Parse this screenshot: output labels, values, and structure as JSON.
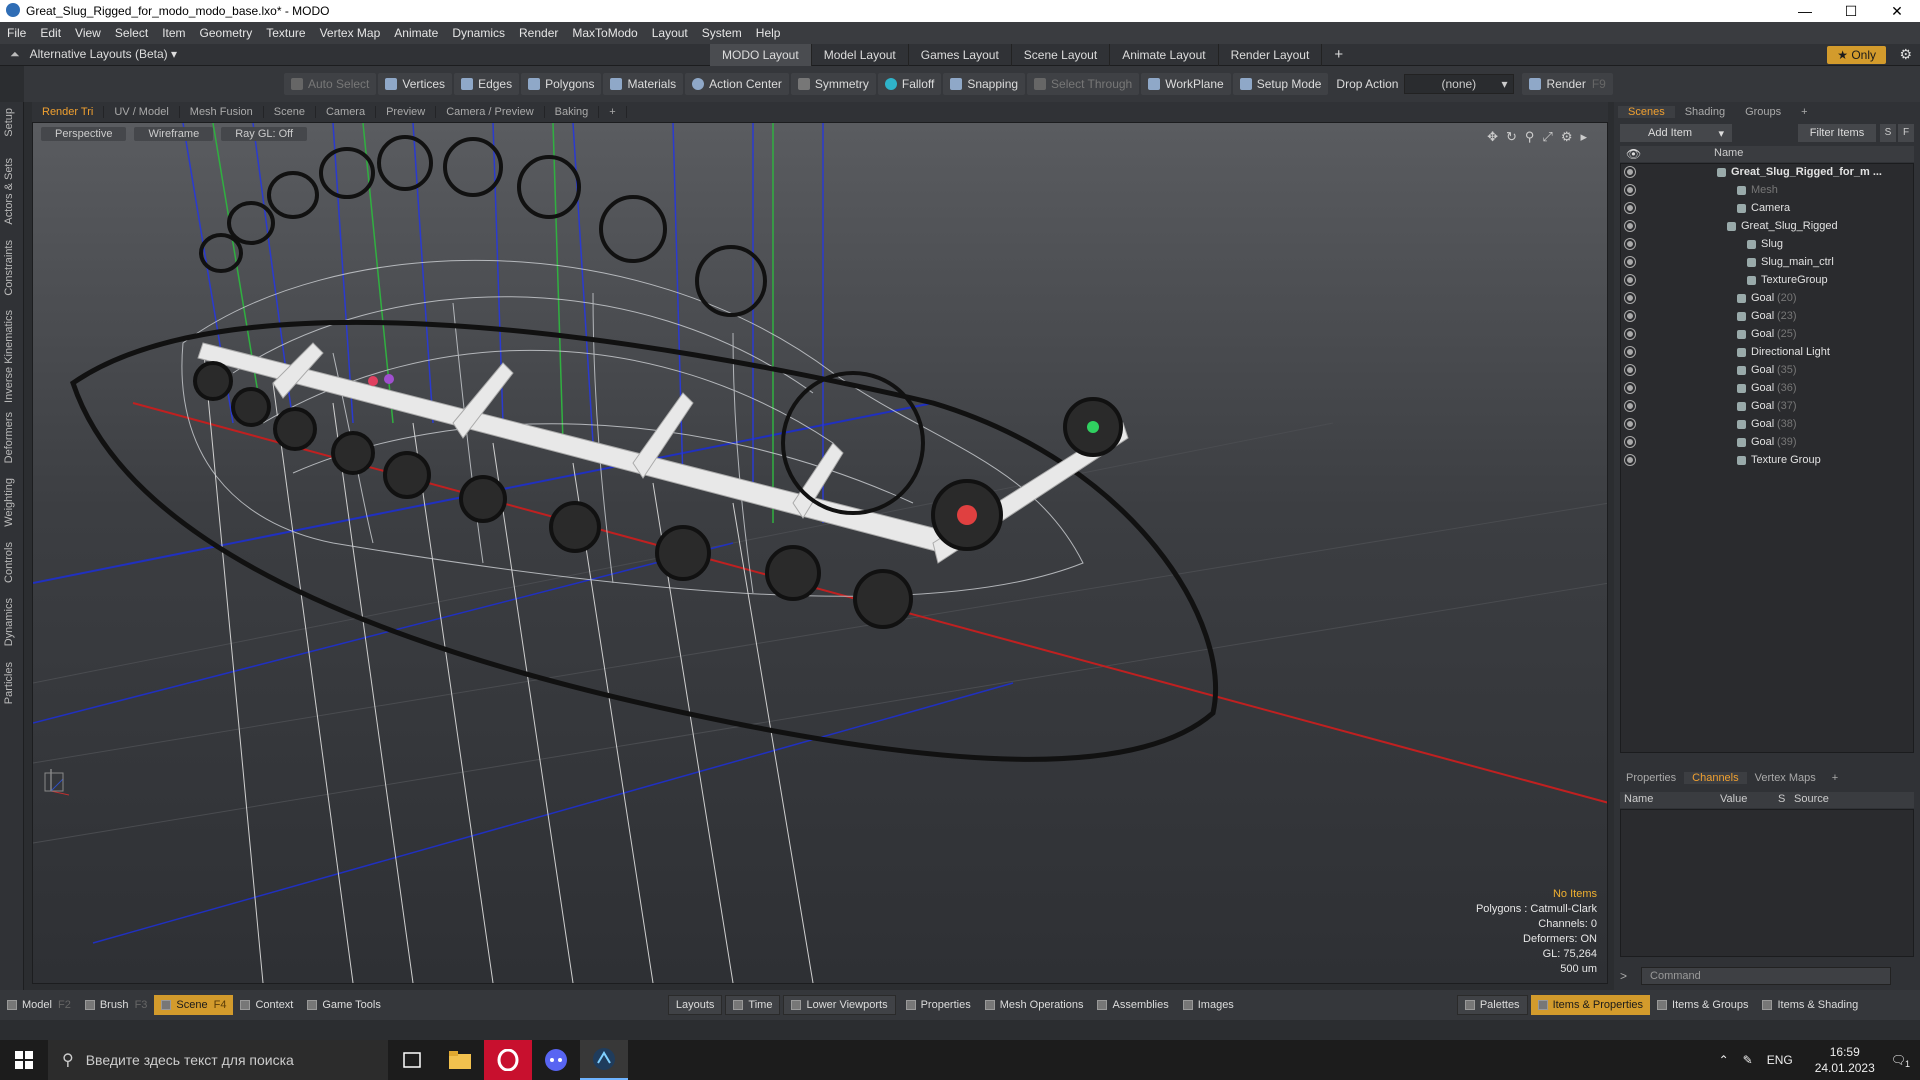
{
  "window": {
    "title": "Great_Slug_Rigged_for_modo_modo_base.lxo* - MODO",
    "controls": [
      "—",
      "☐",
      "✕"
    ]
  },
  "menu": [
    "File",
    "Edit",
    "View",
    "Select",
    "Item",
    "Geometry",
    "Texture",
    "Vertex Map",
    "Animate",
    "Dynamics",
    "Render",
    "MaxToModo",
    "Layout",
    "System",
    "Help"
  ],
  "layoutbar": {
    "alt_layouts": "Alternative Layouts (Beta) ▾",
    "tabs": [
      "MODO Layout",
      "Model Layout",
      "Games Layout",
      "Scene Layout",
      "Animate Layout",
      "Render Layout"
    ],
    "add": "+",
    "only": "★  Only"
  },
  "toolbar": {
    "auto_select": "Auto Select",
    "vertices": "Vertices",
    "edges": "Edges",
    "polygons": "Polygons",
    "materials": "Materials",
    "action_center": "Action Center",
    "symmetry": "Symmetry",
    "falloff": "Falloff",
    "snapping": "Snapping",
    "select_through": "Select Through",
    "workplane": "WorkPlane",
    "setup_mode": "Setup Mode",
    "drop_action": "Drop Action",
    "drop_value": "(none)",
    "render": "Render",
    "render_key": "F9"
  },
  "left_tabs": [
    "Setup",
    "Actors & Sets",
    "Constraints",
    "Inverse Kinematics",
    "Deformers",
    "Weighting",
    "Controls",
    "Dynamics",
    "Particles"
  ],
  "viewport_tabs": [
    "Render Tri",
    "UV / Model",
    "Mesh Fusion",
    "Scene",
    "Camera",
    "Preview",
    "Camera / Preview",
    "Baking",
    "+"
  ],
  "viewport": {
    "view": "Perspective",
    "shading": "Wireframe",
    "raygl": "Ray GL: Off",
    "info": {
      "no_items": "No Items",
      "polygons": "Polygons : Catmull-Clark",
      "channels": "Channels: 0",
      "deformers": "Deformers: ON",
      "gl": "GL: 75,264",
      "scale": "500 um"
    }
  },
  "scene_panel": {
    "tabs": [
      "Scenes",
      "Shading",
      "Groups",
      "+"
    ],
    "add_item": "Add Item",
    "filter_items": "Filter Items",
    "s_btn": "S",
    "f_btn": "F",
    "col_name": "Name",
    "items": [
      {
        "label": "Great_Slug_Rigged_for_m ...",
        "num": "",
        "indent": 0
      },
      {
        "label": "Mesh",
        "num": "",
        "indent": 2
      },
      {
        "label": "Camera",
        "num": "",
        "indent": 2
      },
      {
        "label": "Great_Slug_Rigged",
        "num": "",
        "indent": 1
      },
      {
        "label": "Slug",
        "num": "",
        "indent": 3
      },
      {
        "label": "Slug_main_ctrl",
        "num": "",
        "indent": 3
      },
      {
        "label": "TextureGroup",
        "num": "",
        "indent": 3
      },
      {
        "label": "Goal",
        "num": "(20)",
        "indent": 2
      },
      {
        "label": "Goal",
        "num": "(23)",
        "indent": 2
      },
      {
        "label": "Goal",
        "num": "(25)",
        "indent": 2
      },
      {
        "label": "Directional Light",
        "num": "",
        "indent": 2
      },
      {
        "label": "Goal",
        "num": "(35)",
        "indent": 2
      },
      {
        "label": "Goal",
        "num": "(36)",
        "indent": 2
      },
      {
        "label": "Goal",
        "num": "(37)",
        "indent": 2
      },
      {
        "label": "Goal",
        "num": "(38)",
        "indent": 2
      },
      {
        "label": "Goal",
        "num": "(39)",
        "indent": 2
      },
      {
        "label": "Texture Group",
        "num": "",
        "indent": 2
      }
    ]
  },
  "props_panel": {
    "tabs": [
      "Properties",
      "Channels",
      "Vertex Maps",
      "+"
    ],
    "cols": [
      "Name",
      "Value",
      "S",
      "Source"
    ],
    "command_placeholder": "Command"
  },
  "bottombar": {
    "left": [
      {
        "label": "Model",
        "key": "F2"
      },
      {
        "label": "Brush",
        "key": "F3"
      },
      {
        "label": "Scene",
        "key": "F4"
      },
      {
        "label": "Context",
        "key": ""
      },
      {
        "label": "Game Tools",
        "key": ""
      }
    ],
    "center": [
      "Layouts",
      "Time",
      "Lower Viewports",
      "Properties",
      "Mesh Operations",
      "Assemblies",
      "Images"
    ],
    "right": [
      "Palettes",
      "Items & Properties",
      "Items & Groups",
      "Items & Shading"
    ]
  },
  "taskbar": {
    "search_placeholder": "Введите здесь текст для поиска",
    "lang": "ENG",
    "time": "16:59",
    "date": "24.01.2023",
    "notif": "1"
  }
}
